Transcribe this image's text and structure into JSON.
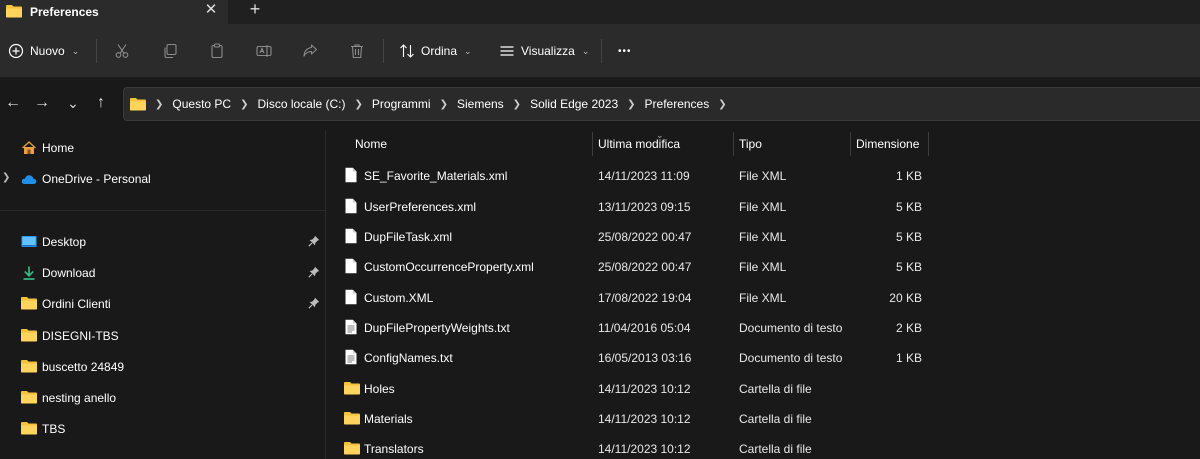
{
  "tab": {
    "title": "Preferences",
    "close_glyph": "✕",
    "new_tab_glyph": "+"
  },
  "toolbar": {
    "new_label": "Nuovo",
    "sort_label": "Ordina",
    "view_label": "Visualizza",
    "more_glyph": "•••",
    "icons": [
      "plus-circle-icon",
      "cut-icon",
      "copy-icon",
      "paste-icon",
      "rename-icon",
      "share-icon",
      "delete-icon",
      "sort-icon",
      "view-icon",
      "more-icon"
    ]
  },
  "nav": {
    "back": "←",
    "forward": "→",
    "recent": "⌄",
    "up": "↑"
  },
  "breadcrumb": [
    "Questo PC",
    "Disco locale (C:)",
    "Programmi",
    "Siemens",
    "Solid Edge 2023",
    "Preferences"
  ],
  "sidebar": {
    "items": [
      {
        "label": "Home",
        "icon": "home-icon"
      },
      {
        "label": "OneDrive - Personal",
        "icon": "cloud-icon"
      },
      {
        "label": "Desktop",
        "icon": "desktop-icon",
        "pinned": true
      },
      {
        "label": "Download",
        "icon": "download-icon",
        "pinned": true
      },
      {
        "label": "Ordini Clienti",
        "icon": "folder-icon",
        "pinned": true
      },
      {
        "label": "DISEGNI-TBS",
        "icon": "folder-icon"
      },
      {
        "label": "buscetto 24849",
        "icon": "folder-icon"
      },
      {
        "label": "nesting anello",
        "icon": "folder-icon"
      },
      {
        "label": "TBS",
        "icon": "folder-icon"
      }
    ]
  },
  "columns": {
    "name": "Nome",
    "modified": "Ultima modifica",
    "type": "Tipo",
    "size": "Dimensione"
  },
  "files": [
    {
      "name": "SE_Favorite_Materials.xml",
      "modified": "14/11/2023 11:09",
      "type": "File XML",
      "size": "1 KB",
      "kind": "file"
    },
    {
      "name": "UserPreferences.xml",
      "modified": "13/11/2023 09:15",
      "type": "File XML",
      "size": "5 KB",
      "kind": "file"
    },
    {
      "name": "DupFileTask.xml",
      "modified": "25/08/2022 00:47",
      "type": "File XML",
      "size": "5 KB",
      "kind": "file"
    },
    {
      "name": "CustomOccurrenceProperty.xml",
      "modified": "25/08/2022 00:47",
      "type": "File XML",
      "size": "5 KB",
      "kind": "file"
    },
    {
      "name": "Custom.XML",
      "modified": "17/08/2022 19:04",
      "type": "File XML",
      "size": "20 KB",
      "kind": "file"
    },
    {
      "name": "DupFilePropertyWeights.txt",
      "modified": "11/04/2016 05:04",
      "type": "Documento di testo",
      "size": "2 KB",
      "kind": "text"
    },
    {
      "name": "ConfigNames.txt",
      "modified": "16/05/2013 03:16",
      "type": "Documento di testo",
      "size": "1 KB",
      "kind": "text"
    },
    {
      "name": "Holes",
      "modified": "14/11/2023 10:12",
      "type": "Cartella di file",
      "size": "",
      "kind": "folder"
    },
    {
      "name": "Materials",
      "modified": "14/11/2023 10:12",
      "type": "Cartella di file",
      "size": "",
      "kind": "folder"
    },
    {
      "name": "Translators",
      "modified": "14/11/2023 10:12",
      "type": "Cartella di file",
      "size": "",
      "kind": "folder"
    }
  ],
  "colors": {
    "folder": "#f4c23b",
    "accent": "#4cc2ff",
    "background": "#191919",
    "toolbar": "#2b2b2b"
  }
}
